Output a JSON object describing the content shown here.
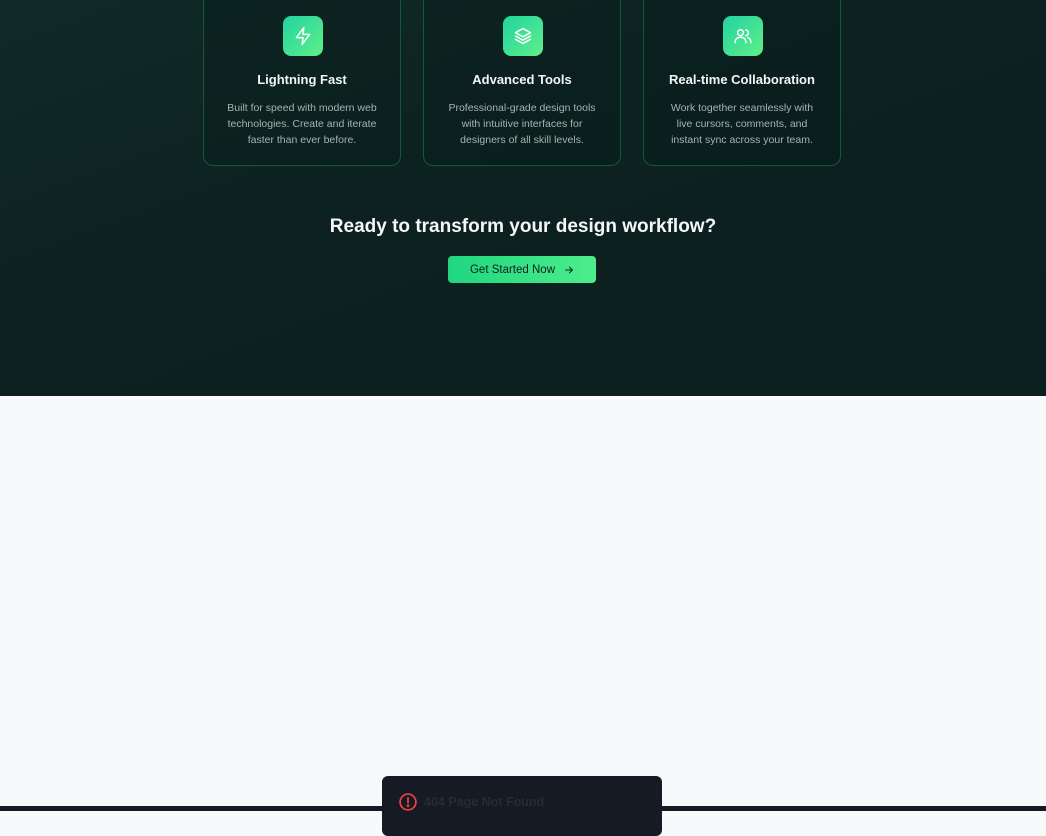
{
  "features": [
    {
      "icon": "lightning-icon",
      "title": "Lightning Fast",
      "description": "Built for speed with modern web technologies. Create and iterate faster than ever before."
    },
    {
      "icon": "layers-icon",
      "title": "Advanced Tools",
      "description": "Professional-grade design tools with intuitive interfaces for designers of all skill levels."
    },
    {
      "icon": "users-icon",
      "title": "Real-time Collaboration",
      "description": "Work together seamlessly with live cursors, comments, and instant sync across your team."
    }
  ],
  "cta": {
    "title": "Ready to transform your design workflow?",
    "button_label": "Get Started Now",
    "button_icon": "arrow-right-icon"
  },
  "toast": {
    "icon": "alert-circle-icon",
    "message": "404 Page Not Found"
  },
  "colors": {
    "accent": "#22c55e",
    "hero_background": "#0c2120",
    "page_background": "#f8f9fb",
    "error": "#ef4444"
  }
}
